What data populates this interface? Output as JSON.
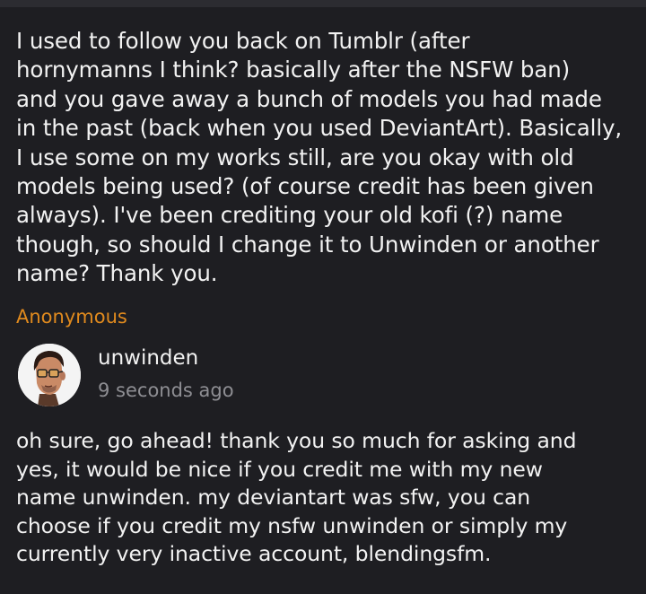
{
  "ask": {
    "question_lines": [
      "I used to follow you back on Tumblr (after",
      "hornymanns I think? basically after the NSFW ban)",
      "and you gave away a bunch of models you had made",
      "in the past (back when you used DeviantArt). Basically,",
      "I use some on my works still, are you okay with old",
      "models being used? (of course credit has been given",
      "always). I've been crediting your old kofi (?) name",
      "though, so should I change it to Unwinden or another",
      "name? Thank you."
    ],
    "asker": "Anonymous",
    "asker_color": "#e08a1e"
  },
  "answer": {
    "author": "unwinden",
    "avatar_icon": "cartoon-man-with-glasses-avatar",
    "timestamp": "9 seconds ago",
    "lines": [
      "oh sure, go ahead! thank you so much for asking and",
      "yes, it would be nice if you credit me with my new",
      "name unwinden. my deviantart was sfw, you can",
      "choose if you credit my nsfw unwinden or simply my",
      "currently very inactive account, blendingsfm."
    ]
  }
}
